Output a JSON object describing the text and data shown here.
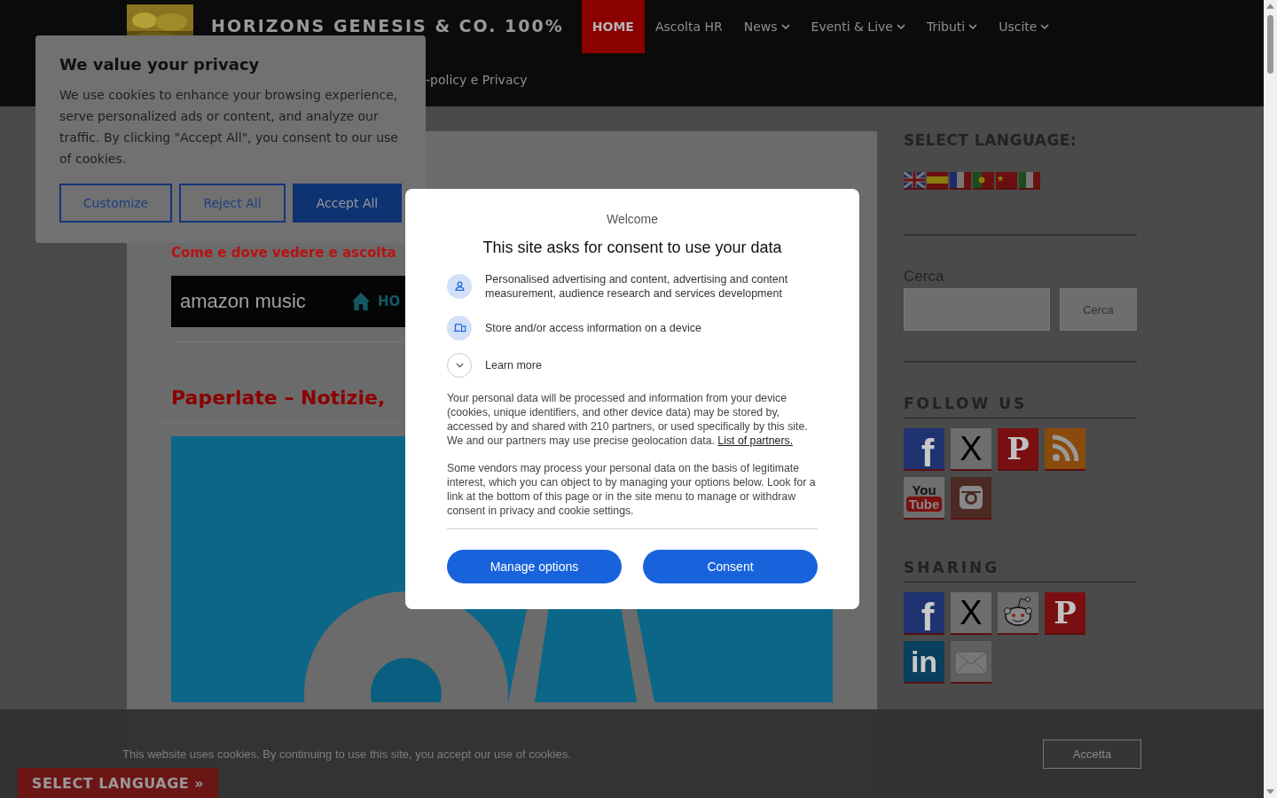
{
  "header": {
    "site_title": "HORIZONS GENESIS & CO. 100%",
    "nav": [
      {
        "label": "HOME",
        "selected": true,
        "dropdown": false
      },
      {
        "label": "Ascolta HR",
        "selected": false,
        "dropdown": false
      },
      {
        "label": "News",
        "selected": false,
        "dropdown": true
      },
      {
        "label": "Eventi & Live",
        "selected": false,
        "dropdown": true
      },
      {
        "label": "Tributi",
        "selected": false,
        "dropdown": true
      },
      {
        "label": "Uscite",
        "selected": false,
        "dropdown": true
      }
    ],
    "nav_second_row": "-policy e Privacy"
  },
  "main": {
    "subtitle": "Come e dove vedere e ascolta",
    "banner": {
      "logo": "amazon music",
      "link": "HO"
    },
    "post_title": "Paperlate – Notizie,"
  },
  "sidebar": {
    "language_heading": "SELECT LANGUAGE:",
    "search_label": "Cerca",
    "search_button": "Cerca",
    "follow_heading": "FOLLOW US",
    "follow_icons": [
      {
        "kind": "facebook",
        "glyph": "f"
      },
      {
        "kind": "x",
        "glyph": "X"
      },
      {
        "kind": "pinterest",
        "glyph": "P"
      },
      {
        "kind": "rss"
      },
      {
        "kind": "youtube",
        "glyph": "You",
        "glyph2": "Tube"
      },
      {
        "kind": "instagram"
      }
    ],
    "sharing_heading": "SHARING",
    "sharing_icons": [
      {
        "kind": "facebook",
        "glyph": "f"
      },
      {
        "kind": "x",
        "glyph": "X"
      },
      {
        "kind": "reddit"
      },
      {
        "kind": "pinterest",
        "glyph": "P"
      },
      {
        "kind": "linkedin",
        "glyph": "in"
      },
      {
        "kind": "email"
      }
    ]
  },
  "privacy_banner": {
    "title": "We value your privacy",
    "text": "We use cookies to enhance your browsing experience, serve personalized ads or content, and analyze our traffic. By clicking \"Accept All\", you consent to our use of cookies.",
    "buttons": [
      {
        "label": "Customize",
        "kind": "outline"
      },
      {
        "label": "Reject All",
        "kind": "outline"
      },
      {
        "label": "Accept All",
        "kind": "solid"
      }
    ]
  },
  "consent_dialog": {
    "welcome": "Welcome",
    "title": "This site asks for consent to use your data",
    "purposes": [
      {
        "kind": "person",
        "text": "Personalised advertising and content, advertising and content measurement, audience research and services development"
      },
      {
        "kind": "device",
        "text": "Store and/or access information on a device"
      }
    ],
    "learn_more": "Learn more",
    "paragraph_1": "Your personal data will be processed and information from your device (cookies, unique identifiers, and other device data) may be stored by, accessed by and shared with 210 partners, or used specifically by this site. We and our partners may use precise geolocation data.",
    "partners_link": "List of partners.",
    "paragraph_2": "Some vendors may process your personal data on the basis of legitimate interest, which you can object to by managing your options below. Look for a link at the bottom of this page or in the site menu to manage or withdraw consent in privacy and cookie settings.",
    "buttons": [
      "Manage options",
      "Consent"
    ]
  },
  "cookie_bar": {
    "text": "This website uses cookies. By continuing to use this site, you accept our use of cookies.",
    "button": "Accetta"
  },
  "language_tab": "SELECT LANGUAGE »"
}
